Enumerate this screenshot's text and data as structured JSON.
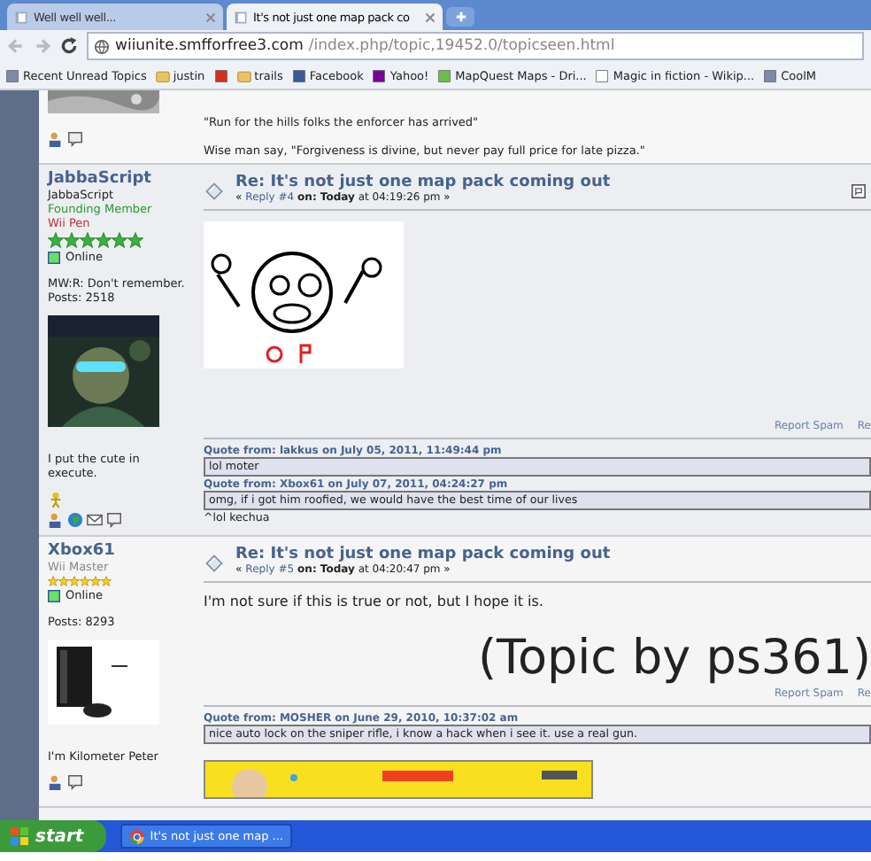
{
  "browser": {
    "tabs": [
      {
        "title": "Well well well...",
        "selected": false
      },
      {
        "title": "It's not just one map pack co",
        "selected": true
      }
    ],
    "url_host": "wiiunite.smfforfree3.com",
    "url_path": "/index.php/topic,19452.0/topicseen.html",
    "bookmarks": [
      {
        "label": "Recent Unread Topics",
        "kind": "page"
      },
      {
        "label": "justin",
        "kind": "folder"
      },
      {
        "kind": "video"
      },
      {
        "label": "trails",
        "kind": "folder"
      },
      {
        "label": "Facebook",
        "kind": "facebook"
      },
      {
        "label": "Yahoo!",
        "kind": "yahoo"
      },
      {
        "label": "MapQuest Maps - Dri...",
        "kind": "map"
      },
      {
        "label": "Magic in fiction - Wikip...",
        "kind": "wiki"
      },
      {
        "label": "CoolM",
        "kind": "page"
      }
    ]
  },
  "previous_post": {
    "signature": [
      "\"Run for the hills folks the enforcer has arrived\"",
      "Wise man say, \"Forgiveness is divine, but never pay full price for late pizza.\""
    ]
  },
  "posts": [
    {
      "author": "JabbaScript",
      "display_name": "JabbaScript",
      "group": "Founding Member",
      "subgroup": "Wii Pen",
      "stars": 6,
      "kind": "founder",
      "online": true,
      "status": "Online",
      "custom_field": "MW:R: Don't remember.",
      "posts": "Posts: 2518",
      "personal_text": "I put the cute in execute.",
      "icons": [
        {
          "kind": "gender"
        },
        {
          "kind": "profile"
        },
        {
          "kind": "globe"
        },
        {
          "kind": "mail"
        },
        {
          "kind": "pm"
        }
      ],
      "title": "Re: It's not just one map pack coming out",
      "reply_prefix": "«",
      "reply": "Reply #4",
      "meta": "**on: Today** at 04:19:26 pm »",
      "body": [
        {
          "kind": "picture"
        }
      ],
      "report": "Report Spam",
      "report_next": "Re",
      "signature": [
        {
          "kind": "quote",
          "header": "Quote from: lakkus on July 05, 2011, 11:49:44 pm",
          "text": "lol moter"
        },
        {
          "kind": "quote",
          "header": "Quote from: Xbox61 on July 07, 2011, 04:24:27 pm",
          "text": "omg, if i got him roofied, we would have the best time of our lives"
        },
        {
          "kind": "text",
          "text": "^lol kechua"
        }
      ]
    },
    {
      "author": "Xbox61",
      "group": "Wii Master",
      "stars": 6,
      "kind": "member",
      "online": true,
      "status": "Online",
      "posts": "Posts: 8293",
      "personal_text": "I'm Kilometer Peter",
      "icons": [
        {
          "kind": "profile"
        },
        {
          "kind": "pm"
        }
      ],
      "title": "Re: It's not just one map pack coming out",
      "reply_prefix": "«",
      "reply": "Reply #5",
      "meta": "**on: Today** at 04:20:47 pm »",
      "body": [
        {
          "kind": "text",
          "text": "I'm not sure if this is true or not, but I hope it is."
        },
        {
          "kind": "big",
          "text": "(Topic by ps361)"
        }
      ],
      "report": "Report Spam",
      "report_next": "Re",
      "signature": [
        {
          "kind": "quote",
          "header": "Quote from: MOSHER on June 29, 2010, 10:37:02 am",
          "text": "nice auto lock on the sniper rifle, i know a hack when i see it. use a real gun."
        },
        {
          "kind": "banner"
        }
      ]
    }
  ],
  "taskbar": {
    "start": "start",
    "tasks": [
      "It's not just one map ..."
    ]
  }
}
